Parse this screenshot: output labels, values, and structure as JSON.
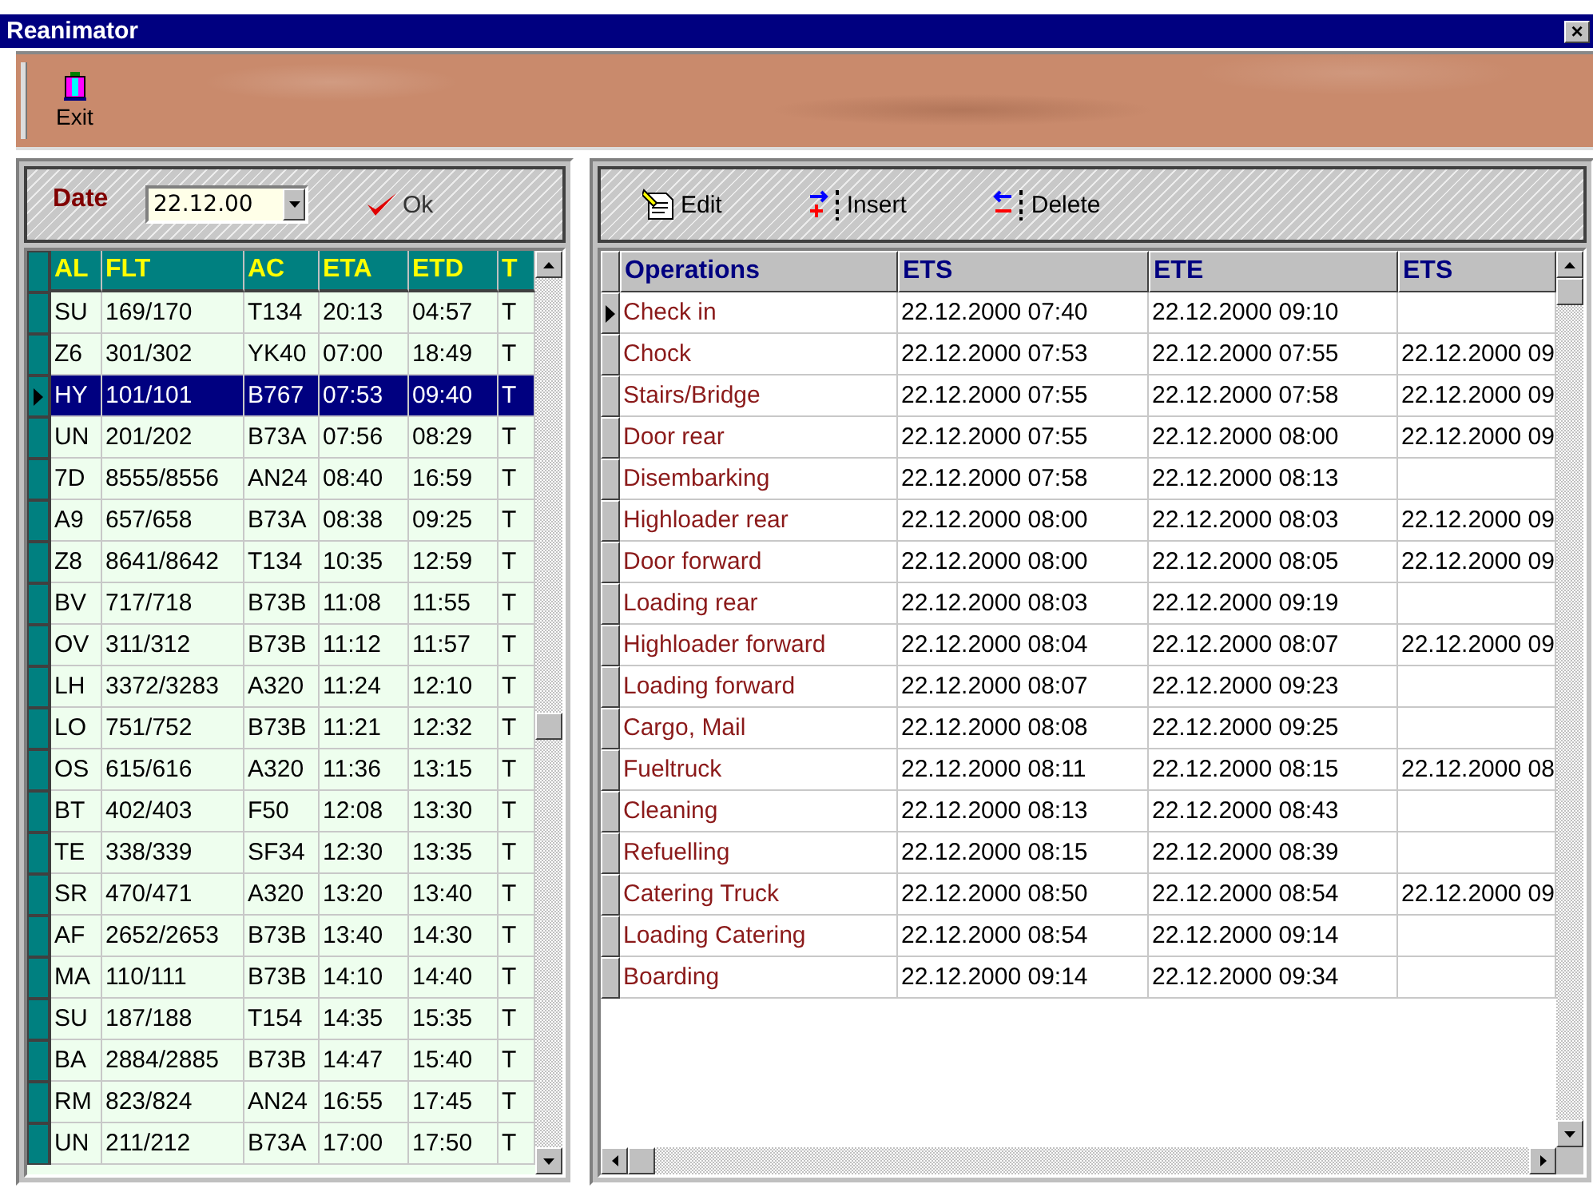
{
  "window": {
    "title": "Reanimator",
    "close": "×"
  },
  "toolbar": {
    "exit_label": "Exit"
  },
  "flights": {
    "date_label": "Date",
    "date_value": "22.12.00",
    "ok_label": "Ok",
    "columns": [
      "AL",
      "FLT",
      "AC",
      "ETA",
      "ETD",
      "T"
    ],
    "rows": [
      {
        "cells": [
          "SU",
          "169/170",
          "T134",
          "20:13",
          "04:57",
          "T"
        ],
        "selected": false
      },
      {
        "cells": [
          "Z6",
          "301/302",
          "YK40",
          "07:00",
          "18:49",
          "T"
        ],
        "selected": false
      },
      {
        "cells": [
          "HY",
          "101/101",
          "B767",
          "07:53",
          "09:40",
          "T"
        ],
        "selected": true
      },
      {
        "cells": [
          "UN",
          "201/202",
          "B73A",
          "07:56",
          "08:29",
          "T"
        ],
        "selected": false
      },
      {
        "cells": [
          "7D",
          "8555/8556",
          "AN24",
          "08:40",
          "16:59",
          "T"
        ],
        "selected": false
      },
      {
        "cells": [
          "A9",
          "657/658",
          "B73A",
          "08:38",
          "09:25",
          "T"
        ],
        "selected": false
      },
      {
        "cells": [
          "Z8",
          "8641/8642",
          "T134",
          "10:35",
          "12:59",
          "T"
        ],
        "selected": false
      },
      {
        "cells": [
          "BV",
          "717/718",
          "B73B",
          "11:08",
          "11:55",
          "T"
        ],
        "selected": false
      },
      {
        "cells": [
          "OV",
          "311/312",
          "B73B",
          "11:12",
          "11:57",
          "T"
        ],
        "selected": false
      },
      {
        "cells": [
          "LH",
          "3372/3283",
          "A320",
          "11:24",
          "12:10",
          "T"
        ],
        "selected": false
      },
      {
        "cells": [
          "LO",
          "751/752",
          "B73B",
          "11:21",
          "12:32",
          "T"
        ],
        "selected": false
      },
      {
        "cells": [
          "OS",
          "615/616",
          "A320",
          "11:36",
          "13:15",
          "T"
        ],
        "selected": false
      },
      {
        "cells": [
          "BT",
          "402/403",
          "F50",
          "12:08",
          "13:30",
          "T"
        ],
        "selected": false
      },
      {
        "cells": [
          "TE",
          "338/339",
          "SF34",
          "12:30",
          "13:35",
          "T"
        ],
        "selected": false
      },
      {
        "cells": [
          "SR",
          "470/471",
          "A320",
          "13:20",
          "13:40",
          "T"
        ],
        "selected": false
      },
      {
        "cells": [
          "AF",
          "2652/2653",
          "B73B",
          "13:40",
          "14:30",
          "T"
        ],
        "selected": false
      },
      {
        "cells": [
          "MA",
          "110/111",
          "B73B",
          "14:10",
          "14:40",
          "T"
        ],
        "selected": false
      },
      {
        "cells": [
          "SU",
          "187/188",
          "T154",
          "14:35",
          "15:35",
          "T"
        ],
        "selected": false
      },
      {
        "cells": [
          "BA",
          "2884/2885",
          "B73B",
          "14:47",
          "15:40",
          "T"
        ],
        "selected": false
      },
      {
        "cells": [
          "RM",
          "823/824",
          "AN24",
          "16:55",
          "17:45",
          "T"
        ],
        "selected": false
      },
      {
        "cells": [
          "UN",
          "211/212",
          "B73A",
          "17:00",
          "17:50",
          "T"
        ],
        "selected": false
      }
    ]
  },
  "operations": {
    "buttons": [
      {
        "kind": "edit",
        "label": "Edit"
      },
      {
        "kind": "insert",
        "label": "Insert"
      },
      {
        "kind": "delete",
        "label": "Delete"
      }
    ],
    "columns": [
      "Operations",
      "ETS",
      "ETE",
      "ETS"
    ],
    "rows": [
      {
        "cells": [
          "Check in",
          "22.12.2000 07:40",
          "22.12.2000 09:10",
          ""
        ],
        "selected": true
      },
      {
        "cells": [
          "Chock",
          "22.12.2000 07:53",
          "22.12.2000 07:55",
          "22.12.2000 09"
        ],
        "selected": false
      },
      {
        "cells": [
          "Stairs/Bridge",
          "22.12.2000 07:55",
          "22.12.2000 07:58",
          "22.12.2000 09"
        ],
        "selected": false
      },
      {
        "cells": [
          "Door rear",
          "22.12.2000 07:55",
          "22.12.2000 08:00",
          "22.12.2000 09"
        ],
        "selected": false
      },
      {
        "cells": [
          "Disembarking",
          "22.12.2000 07:58",
          "22.12.2000 08:13",
          ""
        ],
        "selected": false
      },
      {
        "cells": [
          "Highloader rear",
          "22.12.2000 08:00",
          "22.12.2000 08:03",
          "22.12.2000 09"
        ],
        "selected": false
      },
      {
        "cells": [
          "Door forward",
          "22.12.2000 08:00",
          "22.12.2000 08:05",
          "22.12.2000 09"
        ],
        "selected": false
      },
      {
        "cells": [
          "Loading rear",
          "22.12.2000 08:03",
          "22.12.2000 09:19",
          ""
        ],
        "selected": false
      },
      {
        "cells": [
          "Highloader forward",
          "22.12.2000 08:04",
          "22.12.2000 08:07",
          "22.12.2000 09"
        ],
        "selected": false
      },
      {
        "cells": [
          "Loading forward",
          "22.12.2000 08:07",
          "22.12.2000 09:23",
          ""
        ],
        "selected": false
      },
      {
        "cells": [
          "Cargo, Mail",
          "22.12.2000 08:08",
          "22.12.2000 09:25",
          ""
        ],
        "selected": false
      },
      {
        "cells": [
          "Fueltruck",
          "22.12.2000 08:11",
          "22.12.2000 08:15",
          "22.12.2000 08"
        ],
        "selected": false
      },
      {
        "cells": [
          "Cleaning",
          "22.12.2000 08:13",
          "22.12.2000 08:43",
          ""
        ],
        "selected": false
      },
      {
        "cells": [
          "Refuelling",
          "22.12.2000 08:15",
          "22.12.2000 08:39",
          ""
        ],
        "selected": false
      },
      {
        "cells": [
          "Catering Truck",
          "22.12.2000 08:50",
          "22.12.2000 08:54",
          "22.12.2000 09"
        ],
        "selected": false
      },
      {
        "cells": [
          "Loading Catering",
          "22.12.2000 08:54",
          "22.12.2000 09:14",
          ""
        ],
        "selected": false
      },
      {
        "cells": [
          "Boarding",
          "22.12.2000 09:14",
          "22.12.2000 09:34",
          ""
        ],
        "selected": false
      }
    ]
  }
}
